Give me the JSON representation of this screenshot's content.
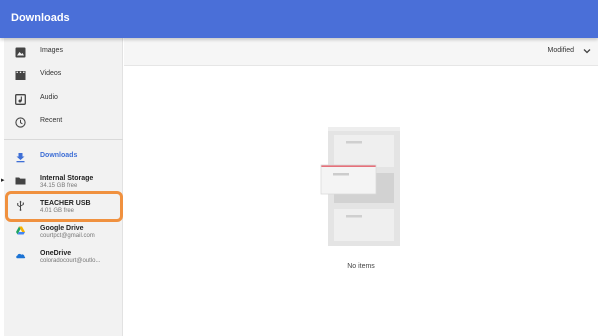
{
  "header": {
    "title": "Downloads"
  },
  "sidebar": {
    "items": [
      {
        "label": "Images",
        "icon": "image-icon"
      },
      {
        "label": "Videos",
        "icon": "video-icon"
      },
      {
        "label": "Audio",
        "icon": "audio-icon"
      },
      {
        "label": "Recent",
        "icon": "clock-icon"
      },
      {
        "label": "Downloads",
        "icon": "download-icon",
        "active": true
      },
      {
        "label": "Internal Storage",
        "sub": "34.15 GB free",
        "icon": "folder-icon"
      },
      {
        "label": "TEACHER USB",
        "sub": "4.01 GB free",
        "icon": "usb-icon"
      },
      {
        "label": "Google Drive",
        "sub": "courtpct@gmail.com",
        "icon": "google-drive-icon"
      },
      {
        "label": "OneDrive",
        "sub": "coloradocourt@outlo...",
        "icon": "onedrive-icon"
      }
    ]
  },
  "toolbar": {
    "sort_label": "Modified"
  },
  "main": {
    "empty_text": "No items"
  },
  "colors": {
    "header": "#4a6fd8",
    "accent": "#3e6fd6",
    "highlight": "#f0913f"
  }
}
